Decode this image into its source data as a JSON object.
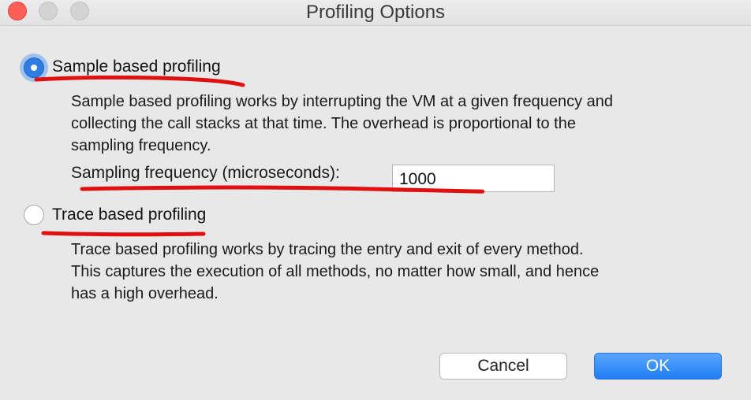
{
  "window": {
    "title": "Profiling Options",
    "controls": [
      "close",
      "minimize",
      "maximize"
    ]
  },
  "sample_option": {
    "label": "Sample based profiling",
    "selected": true,
    "description_lines": [
      "Sample based profiling works by interrupting the VM at a given frequency and",
      "collecting the call stacks at that time. The overhead is proportional to the",
      "sampling frequency."
    ],
    "frequency_label": "Sampling frequency (microseconds):",
    "frequency_value": "1000"
  },
  "trace_option": {
    "label": "Trace based profiling",
    "selected": false,
    "description_lines": [
      "Trace based profiling works by tracing the entry and exit of every method.",
      "This captures the execution of all methods, no matter how small, and hence",
      "has a high overhead."
    ]
  },
  "buttons": {
    "cancel": "Cancel",
    "ok": "OK"
  },
  "colors": {
    "accent": "#2f7de1",
    "annotation": "#e01010",
    "close": "#fc5f57"
  }
}
